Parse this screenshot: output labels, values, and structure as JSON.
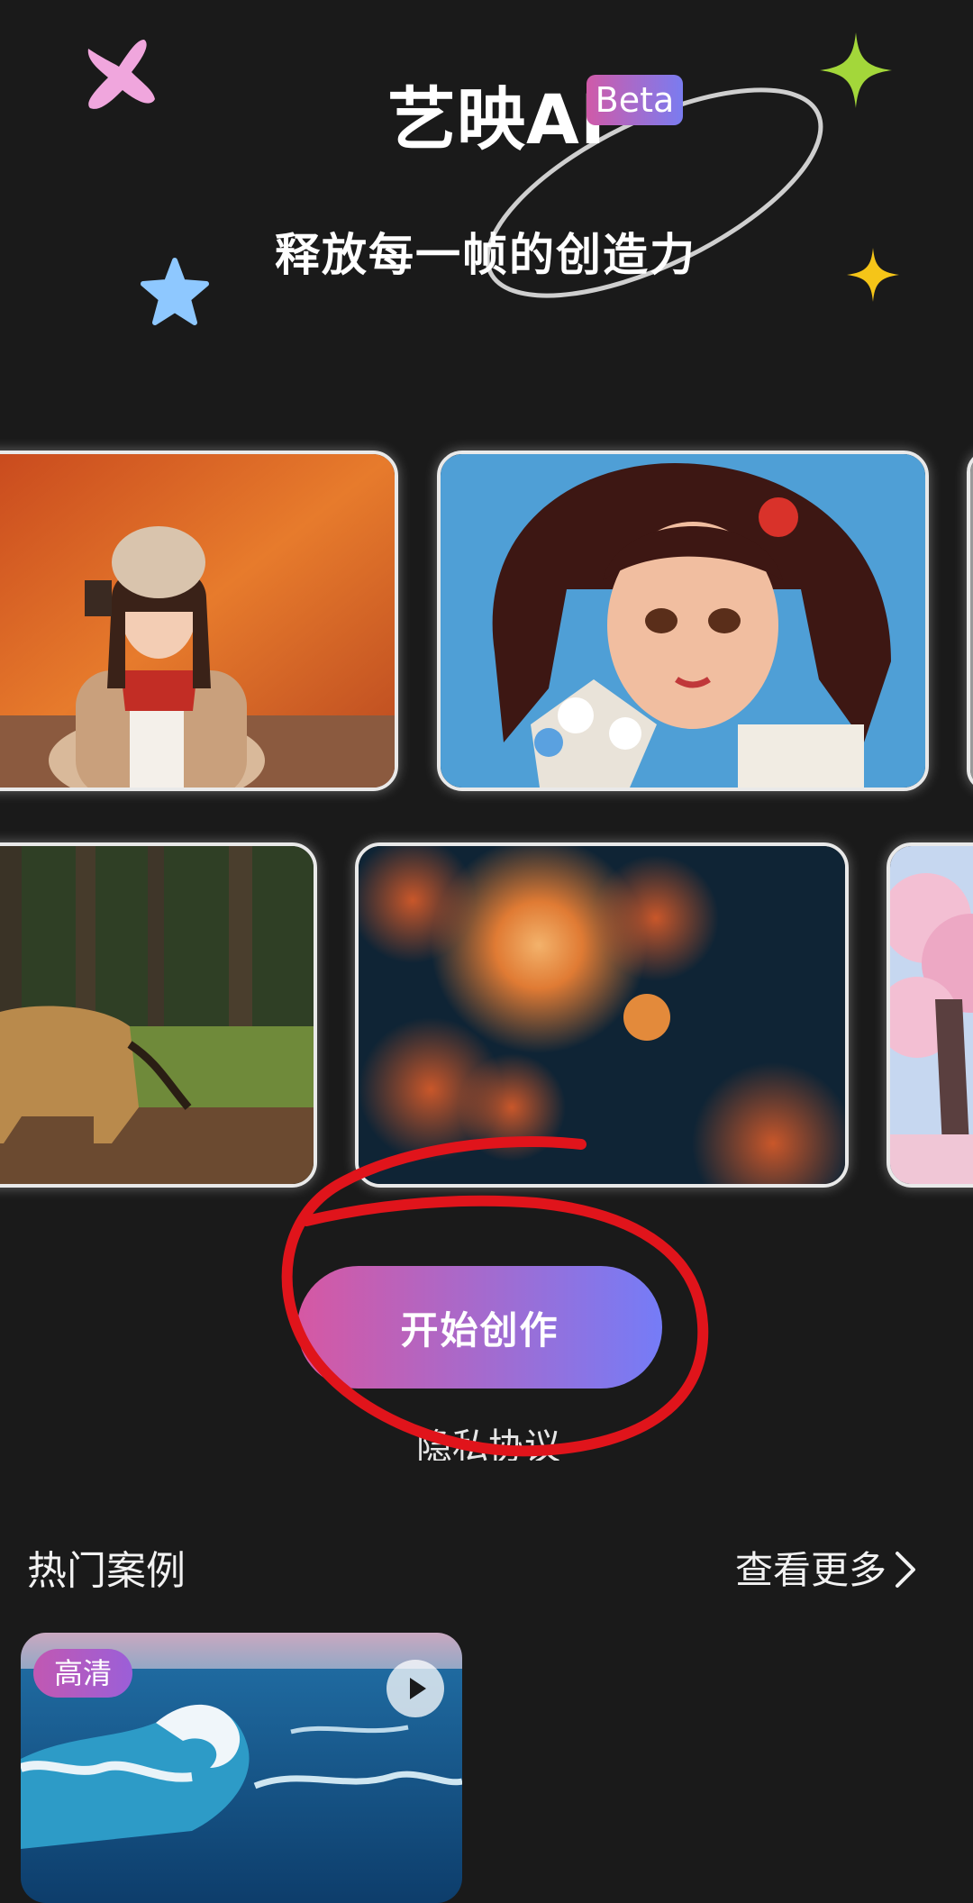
{
  "header": {
    "app_name": "艺映AI",
    "badge": "Beta",
    "slogan": "释放每一帧的创造力"
  },
  "gallery": {
    "row1": [
      {
        "icon": "woman-autumn-photo"
      },
      {
        "icon": "anime-girl-flowers-illustration"
      },
      {
        "icon": "partial-image"
      }
    ],
    "row2": [
      {
        "icon": "lion-forest-photo"
      },
      {
        "icon": "fireworks-night-image"
      },
      {
        "icon": "cherry-blossom-illustration"
      }
    ]
  },
  "actions": {
    "start_label": "开始创作",
    "privacy_label": "隐私协议"
  },
  "annotation": {
    "color": "#e0141b"
  },
  "hot_cases": {
    "title": "热门案例",
    "see_more": "查看更多",
    "items": [
      {
        "badge": "高清",
        "icon": "ocean-wave-thumbnail"
      }
    ]
  },
  "colors": {
    "background": "#1a1a1a",
    "accent_start": "#d658a3",
    "accent_end": "#757cf7"
  }
}
